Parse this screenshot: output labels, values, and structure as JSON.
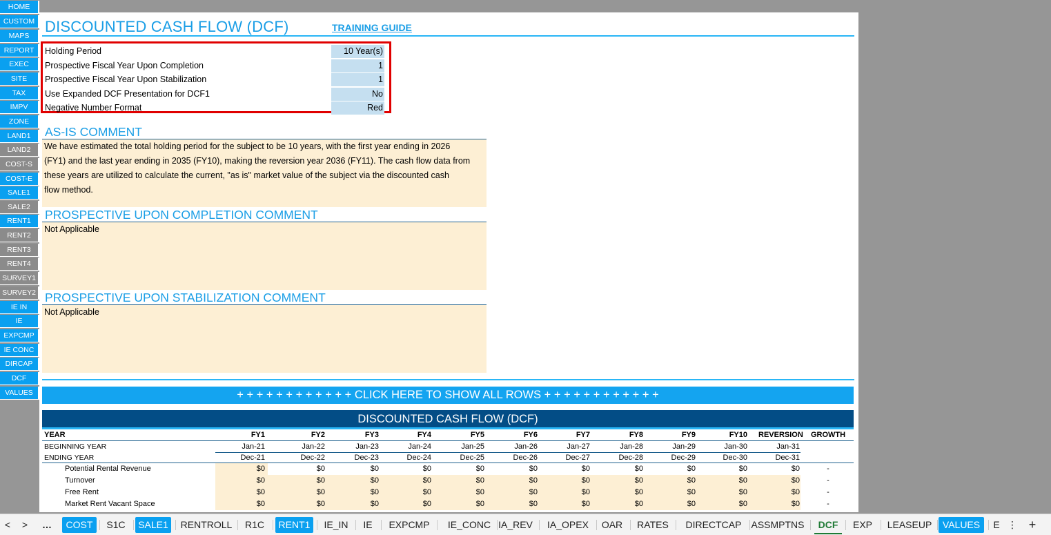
{
  "sidebar": {
    "items": [
      {
        "label": "HOME",
        "style": "blue"
      },
      {
        "label": "CUSTOM",
        "style": "blue"
      },
      {
        "label": "MAPS",
        "style": "blue"
      },
      {
        "label": "REPORT",
        "style": "blue"
      },
      {
        "label": "EXEC",
        "style": "blue"
      },
      {
        "label": "SITE",
        "style": "blue"
      },
      {
        "label": "TAX",
        "style": "blue"
      },
      {
        "label": "IMPV",
        "style": "blue"
      },
      {
        "label": "ZONE",
        "style": "blue"
      },
      {
        "label": "LAND1",
        "style": "blue"
      },
      {
        "label": "LAND2",
        "style": "gray"
      },
      {
        "label": "COST-S",
        "style": "gray"
      },
      {
        "label": "COST-E",
        "style": "blue"
      },
      {
        "label": "SALE1",
        "style": "blue"
      },
      {
        "label": "SALE2",
        "style": "gray"
      },
      {
        "label": "RENT1",
        "style": "blue"
      },
      {
        "label": "RENT2",
        "style": "gray"
      },
      {
        "label": "RENT3",
        "style": "gray"
      },
      {
        "label": "RENT4",
        "style": "gray"
      },
      {
        "label": "SURVEY1",
        "style": "gray"
      },
      {
        "label": "SURVEY2",
        "style": "gray"
      },
      {
        "label": "IE IN",
        "style": "blue"
      },
      {
        "label": "IE",
        "style": "blue"
      },
      {
        "label": "EXPCMP",
        "style": "blue"
      },
      {
        "label": "IE CONC",
        "style": "blue"
      },
      {
        "label": "DIRCAP",
        "style": "blue"
      },
      {
        "label": "DCF",
        "style": "blue"
      },
      {
        "label": "VALUES",
        "style": "blue"
      }
    ]
  },
  "header": {
    "title": "DISCOUNTED CASH FLOW (DCF)",
    "training_link": "TRAINING GUIDE"
  },
  "settings": [
    {
      "label": "Holding Period",
      "value": "10 Year(s)"
    },
    {
      "label": "Prospective Fiscal Year Upon Completion",
      "value": "1"
    },
    {
      "label": "Prospective Fiscal Year Upon Stabilization",
      "value": "1"
    },
    {
      "label": "Use Expanded DCF Presentation for DCF1",
      "value": "No"
    },
    {
      "label": "Negative Number Format",
      "value": "Red"
    }
  ],
  "comments": {
    "as_is": {
      "heading": "AS-IS COMMENT",
      "lines": [
        "We have estimated the total holding period for the subject to be 10 years, with the first year ending in 2026",
        "(FY1) and the last year ending in 2035 (FY10), making the reversion year 2036 (FY11). The cash flow data from",
        "these years are utilized to calculate the current, \"as is\" market value of the subject via the discounted cash",
        "flow method."
      ]
    },
    "completion": {
      "heading": "PROSPECTIVE UPON COMPLETION COMMENT",
      "text": "Not Applicable"
    },
    "stabilization": {
      "heading": "PROSPECTIVE UPON STABILIZATION COMMENT",
      "text": "Not Applicable"
    }
  },
  "show_all_bar": "+ + + + + + + + + + + + CLICK HERE TO SHOW ALL ROWS + + + + + + + + + + + +",
  "dcf_table": {
    "heading": "DISCOUNTED CASH FLOW (DCF)",
    "year_label": "YEAR",
    "columns": [
      "FY1",
      "FY2",
      "FY3",
      "FY4",
      "FY5",
      "FY6",
      "FY7",
      "FY8",
      "FY9",
      "FY10",
      "REVERSION",
      "GROWTH"
    ],
    "beginning_year": {
      "label": "BEGINNING YEAR",
      "values": [
        "Jan-21",
        "Jan-22",
        "Jan-23",
        "Jan-24",
        "Jan-25",
        "Jan-26",
        "Jan-27",
        "Jan-28",
        "Jan-29",
        "Jan-30",
        "Jan-31"
      ]
    },
    "ending_year": {
      "label": "ENDING YEAR",
      "values": [
        "Dec-21",
        "Dec-22",
        "Dec-23",
        "Dec-24",
        "Dec-25",
        "Dec-26",
        "Dec-27",
        "Dec-28",
        "Dec-29",
        "Dec-30",
        "Dec-31"
      ]
    },
    "rows": [
      {
        "label": "Potential Rental Revenue",
        "values": [
          "$0",
          "$0",
          "$0",
          "$0",
          "$0",
          "$0",
          "$0",
          "$0",
          "$0",
          "$0",
          "$0"
        ],
        "growth": "-"
      },
      {
        "label": "Turnover",
        "values": [
          "$0",
          "$0",
          "$0",
          "$0",
          "$0",
          "$0",
          "$0",
          "$0",
          "$0",
          "$0",
          "$0"
        ],
        "growth": "-"
      },
      {
        "label": "Free Rent",
        "values": [
          "$0",
          "$0",
          "$0",
          "$0",
          "$0",
          "$0",
          "$0",
          "$0",
          "$0",
          "$0",
          "$0"
        ],
        "growth": "-"
      },
      {
        "label": "Market Rent Vacant Space",
        "values": [
          "$0",
          "$0",
          "$0",
          "$0",
          "$0",
          "$0",
          "$0",
          "$0",
          "$0",
          "$0",
          "$0"
        ],
        "growth": "-"
      }
    ]
  },
  "tabbar": {
    "nav_prev": "<",
    "nav_next": ">",
    "more": "…",
    "tabs": [
      {
        "label": "COST",
        "style": "blue"
      },
      {
        "label": "S1C",
        "style": "plain"
      },
      {
        "label": "SALE1",
        "style": "blue"
      },
      {
        "label": "RENTROLL",
        "style": "plain"
      },
      {
        "label": "R1C",
        "style": "plain"
      },
      {
        "label": "RENT1",
        "style": "blue"
      },
      {
        "label": "IE_IN",
        "style": "plain"
      },
      {
        "label": "IE",
        "style": "plain"
      },
      {
        "label": "EXPCMP",
        "style": "plain"
      },
      {
        "label": "IE_CONC",
        "style": "plain"
      },
      {
        "label": "IA_REV",
        "style": "plain"
      },
      {
        "label": "IA_OPEX",
        "style": "plain"
      },
      {
        "label": "OAR",
        "style": "plain"
      },
      {
        "label": "RATES",
        "style": "plain"
      },
      {
        "label": "DIRECTCAP",
        "style": "plain"
      },
      {
        "label": "ASSMPTNS",
        "style": "plain"
      },
      {
        "label": "DCF",
        "style": "active"
      },
      {
        "label": "EXP",
        "style": "plain"
      },
      {
        "label": "LEASEUP",
        "style": "plain"
      },
      {
        "label": "VALUES",
        "style": "blue"
      },
      {
        "label": "E",
        "style": "plain"
      }
    ],
    "more_right": "⋮",
    "add": "+"
  }
}
